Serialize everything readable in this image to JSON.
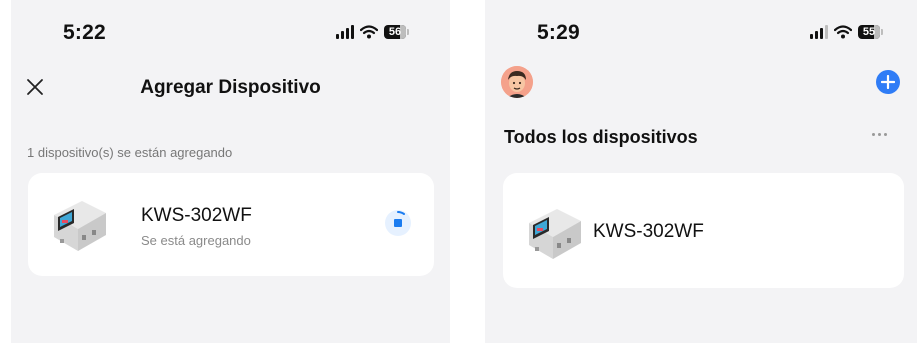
{
  "left": {
    "status_bar": {
      "time": "5:22",
      "battery": "56"
    },
    "header": {
      "title": "Agregar Dispositivo"
    },
    "adding_note": "1 dispositivo(s) se están agregando",
    "device": {
      "name": "KWS-302WF",
      "status": "Se está agregando"
    }
  },
  "right": {
    "status_bar": {
      "time": "5:29",
      "battery": "55"
    },
    "section_title": "Todos los dispositivos",
    "device": {
      "name": "KWS-302WF"
    }
  },
  "colors": {
    "accent": "#2f7cf6",
    "background": "#f3f3f5",
    "card": "#ffffff"
  }
}
